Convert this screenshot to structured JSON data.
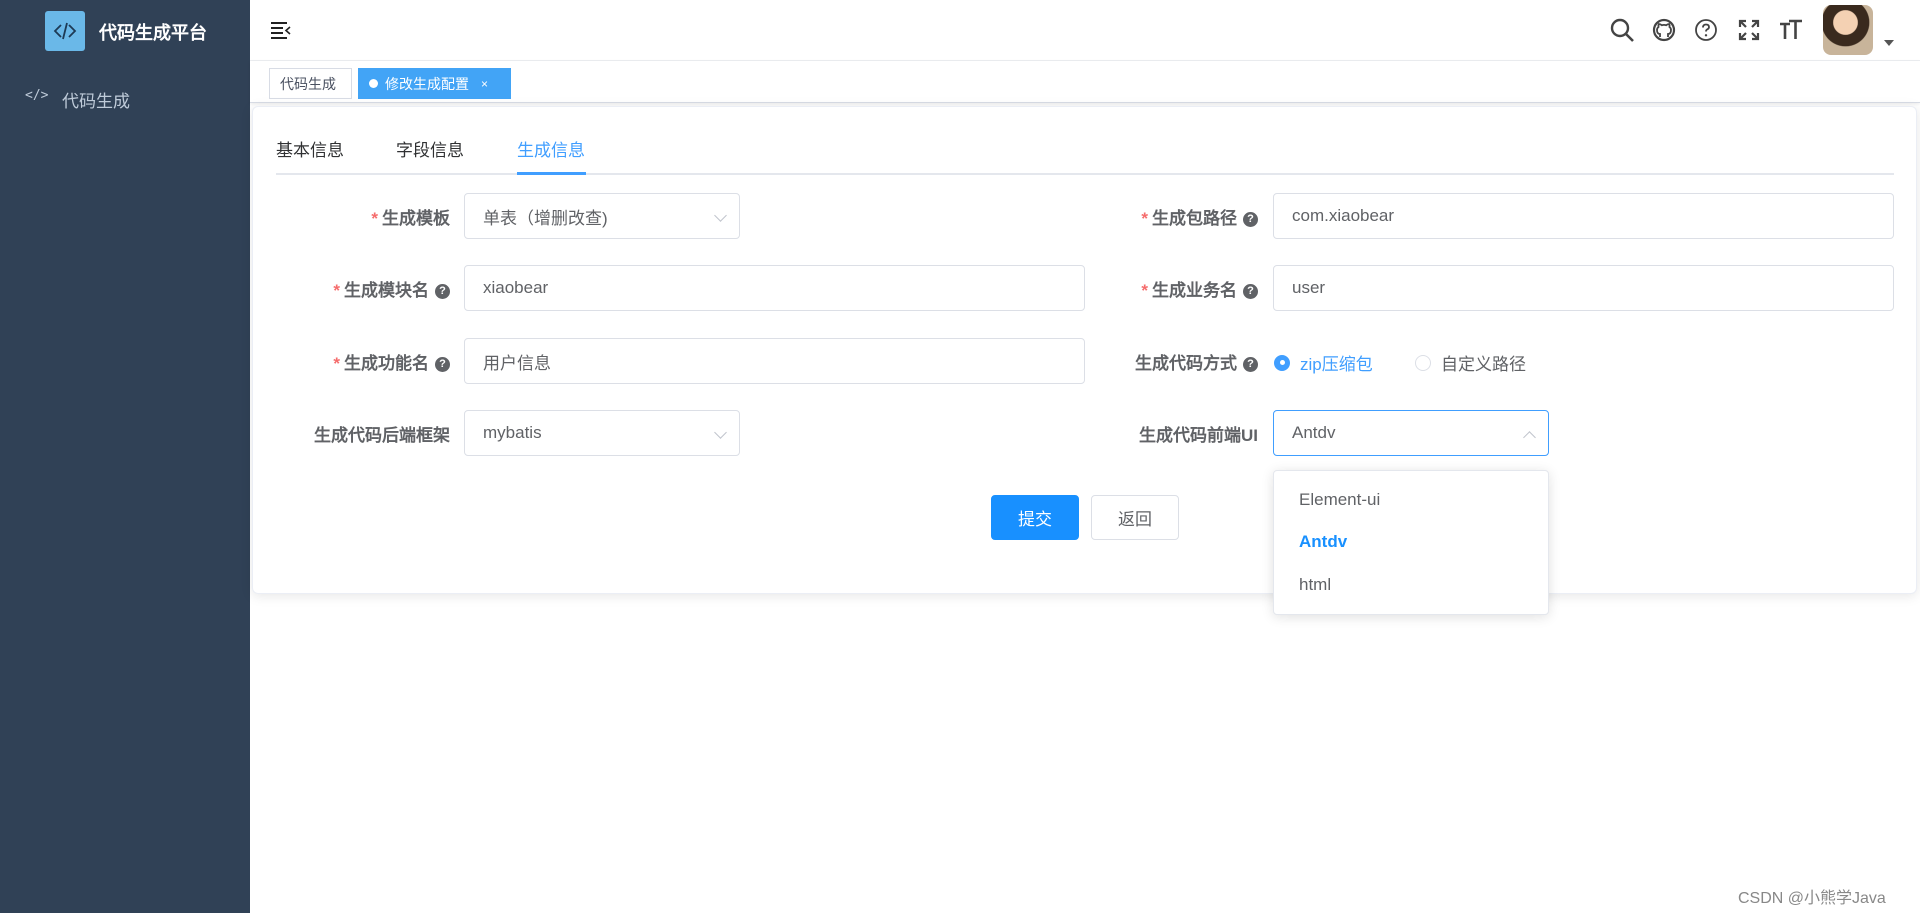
{
  "app": {
    "title": "代码生成平台"
  },
  "sidebar": {
    "items": [
      {
        "label": "代码生成",
        "icon": "code-icon"
      }
    ]
  },
  "tags": [
    {
      "label": "代码生成",
      "active": false
    },
    {
      "label": "修改生成配置",
      "active": true,
      "close": "×"
    }
  ],
  "tabs": [
    {
      "label": "基本信息"
    },
    {
      "label": "字段信息"
    },
    {
      "label": "生成信息",
      "active": true
    }
  ],
  "form": {
    "tpl_category": {
      "label": "生成模板",
      "value": "单表（增删改查)"
    },
    "package_name": {
      "label": "生成包路径",
      "value": "com.xiaobear"
    },
    "module_name": {
      "label": "生成模块名",
      "value": "xiaobear"
    },
    "business_name": {
      "label": "生成业务名",
      "value": "user"
    },
    "function_name": {
      "label": "生成功能名",
      "value": "用户信息"
    },
    "gen_type": {
      "label": "生成代码方式",
      "options": [
        "zip压缩包",
        "自定义路径"
      ],
      "selected": "zip压缩包"
    },
    "backend_framework": {
      "label": "生成代码后端框架",
      "value": "mybatis"
    },
    "frontend_ui": {
      "label": "生成代码前端UI",
      "value": "Antdv",
      "options": [
        "Element-ui",
        "Antdv",
        "html"
      ]
    }
  },
  "buttons": {
    "submit": "提交",
    "back": "返回"
  },
  "help_icon": "?",
  "required_mark": "*",
  "watermark": "CSDN @小熊学Java",
  "colors": {
    "sidebar": "#304156",
    "accent": "#409eff",
    "primary_button": "#1890ff",
    "required": "#f56c6c"
  }
}
